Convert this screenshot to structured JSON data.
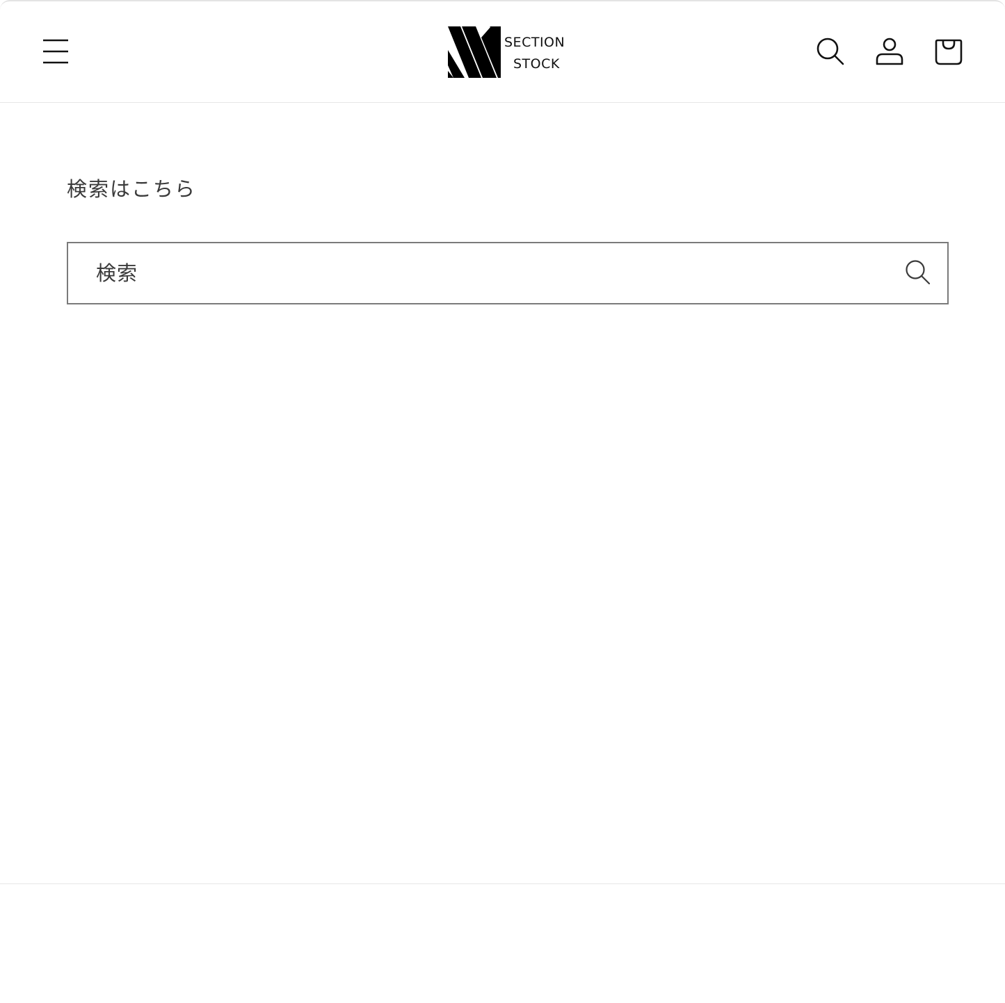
{
  "header": {
    "logo": {
      "line1": "SECTION",
      "line2": "STOCK"
    },
    "icons": {
      "menu": "hamburger-menu-icon",
      "search": "search-icon",
      "account": "account-icon",
      "cart": "cart-icon"
    }
  },
  "main": {
    "title": "検索はこちら",
    "search": {
      "placeholder": "検索",
      "value": "",
      "submit_icon": "search-icon"
    }
  },
  "colors": {
    "text": "#121212",
    "muted_text": "#3a3a3a",
    "input_border": "#7a7a7a",
    "divider": "#e6e6e6",
    "background": "#ffffff"
  }
}
